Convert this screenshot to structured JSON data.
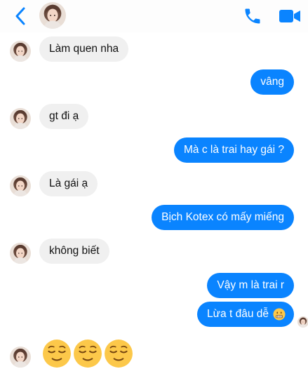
{
  "colors": {
    "accent": "#0a84ff",
    "incoming_bubble": "#f0f0f0",
    "outgoing_bubble": "#0a84ff"
  },
  "header": {
    "back_icon": "chevron-left-icon",
    "call_icon": "phone-icon",
    "video_icon": "video-camera-icon"
  },
  "messages": [
    {
      "side": "in",
      "text": "Làm quen nha"
    },
    {
      "side": "out",
      "text": "vâng"
    },
    {
      "side": "in",
      "text": "gt đi ạ"
    },
    {
      "side": "out",
      "text": "Mà c là trai hay gái ?"
    },
    {
      "side": "in",
      "text": "Là gái ạ"
    },
    {
      "side": "out",
      "text": "Bịch Kotex có mấy miếng"
    },
    {
      "side": "in",
      "text": "không biết"
    },
    {
      "side": "out",
      "text": "Vậy m là trai r"
    },
    {
      "side": "out",
      "text": "Lừa t đâu dễ",
      "emoji": "grimacing-face"
    }
  ],
  "last_reply": {
    "emojis": [
      "relieved-face",
      "relieved-face",
      "relieved-face"
    ]
  }
}
